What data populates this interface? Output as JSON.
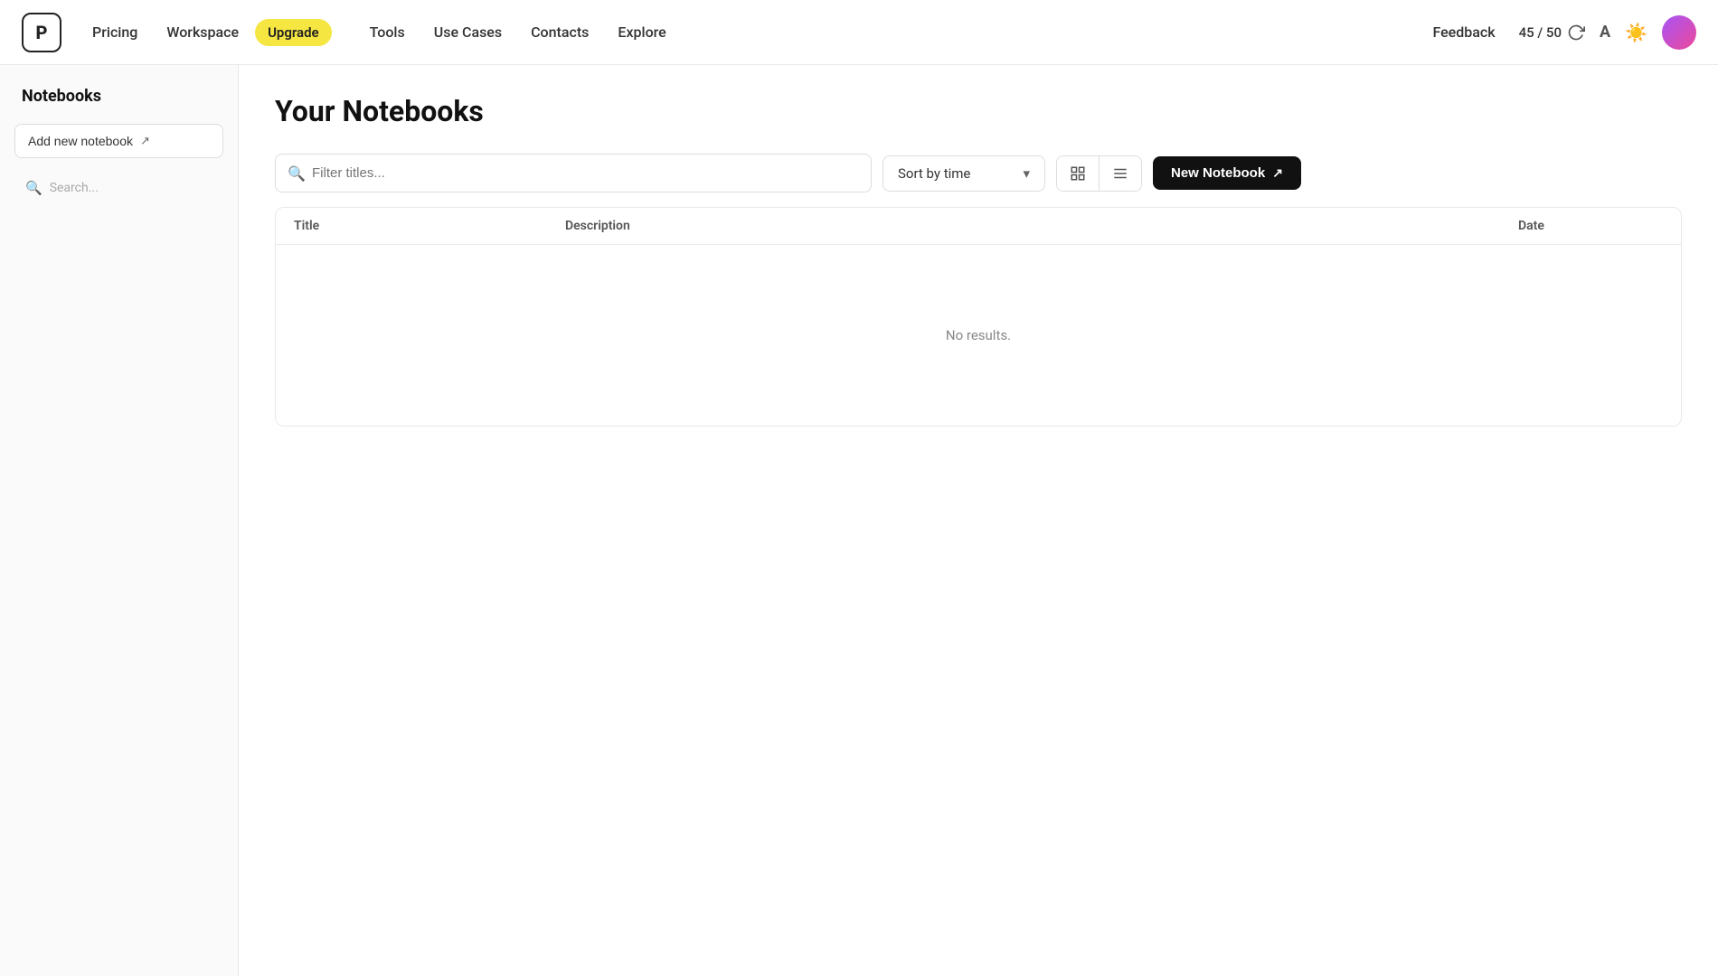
{
  "logo": {
    "letter": "P"
  },
  "navbar": {
    "pricing_label": "Pricing",
    "workspace_label": "Workspace",
    "upgrade_label": "Upgrade",
    "tools_label": "Tools",
    "use_cases_label": "Use Cases",
    "contacts_label": "Contacts",
    "explore_label": "Explore",
    "feedback_label": "Feedback",
    "usage_label": "45 / 50"
  },
  "sidebar": {
    "title": "Notebooks",
    "add_notebook_label": "Add new notebook",
    "search_placeholder": "Search..."
  },
  "main": {
    "page_title": "Your Notebooks",
    "filter_placeholder": "Filter titles...",
    "sort_label": "Sort by time",
    "new_notebook_label": "New Notebook",
    "no_results": "No results.",
    "table": {
      "col_title": "Title",
      "col_description": "Description",
      "col_date": "Date"
    }
  },
  "icons": {
    "search": "🔍",
    "add": "↗",
    "grid": "⊞",
    "list": "≡",
    "chevron_down": "▾",
    "refresh": "↻",
    "lang": "A",
    "sun": "☀",
    "external_link": "↗"
  }
}
